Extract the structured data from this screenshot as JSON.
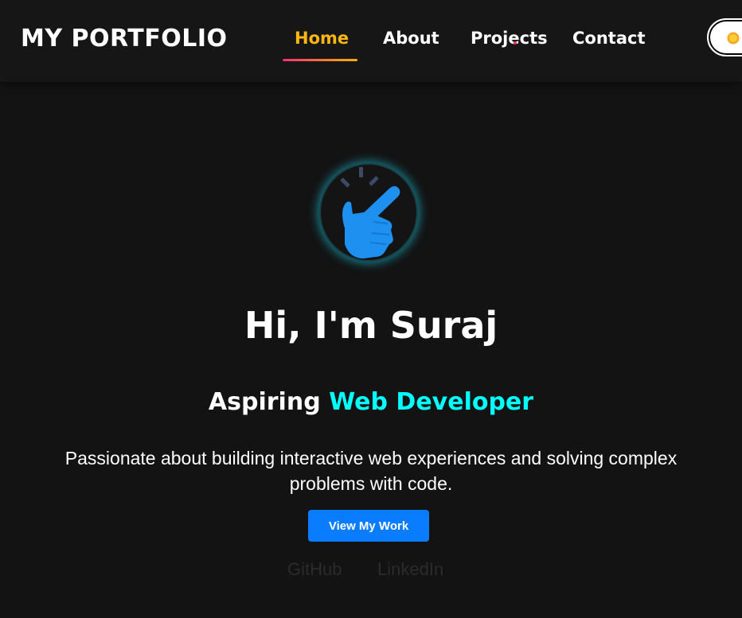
{
  "nav": {
    "brand": "MY PORTFOLIO",
    "links": [
      "Home",
      "About",
      "Projects",
      "Contact"
    ],
    "active": "Home",
    "theme_toggle_icon": "sun-icon"
  },
  "hero": {
    "avatar_icon": "pointing-hand-icon",
    "title": "Hi, I'm Suraj",
    "subtitle_prefix": "Aspiring",
    "subtitle_highlight": "Web Developer",
    "description": "Passionate about building interactive web experiences and solving complex problems with code.",
    "cta_label": "View My Work"
  },
  "social": {
    "github": "GitHub",
    "linkedin": "LinkedIn"
  },
  "colors": {
    "background": "#131313",
    "nav_active": "#ffb610",
    "highlight": "#00ffff",
    "button": "#0a7cff",
    "avatar_glow": "#1aaabe"
  }
}
